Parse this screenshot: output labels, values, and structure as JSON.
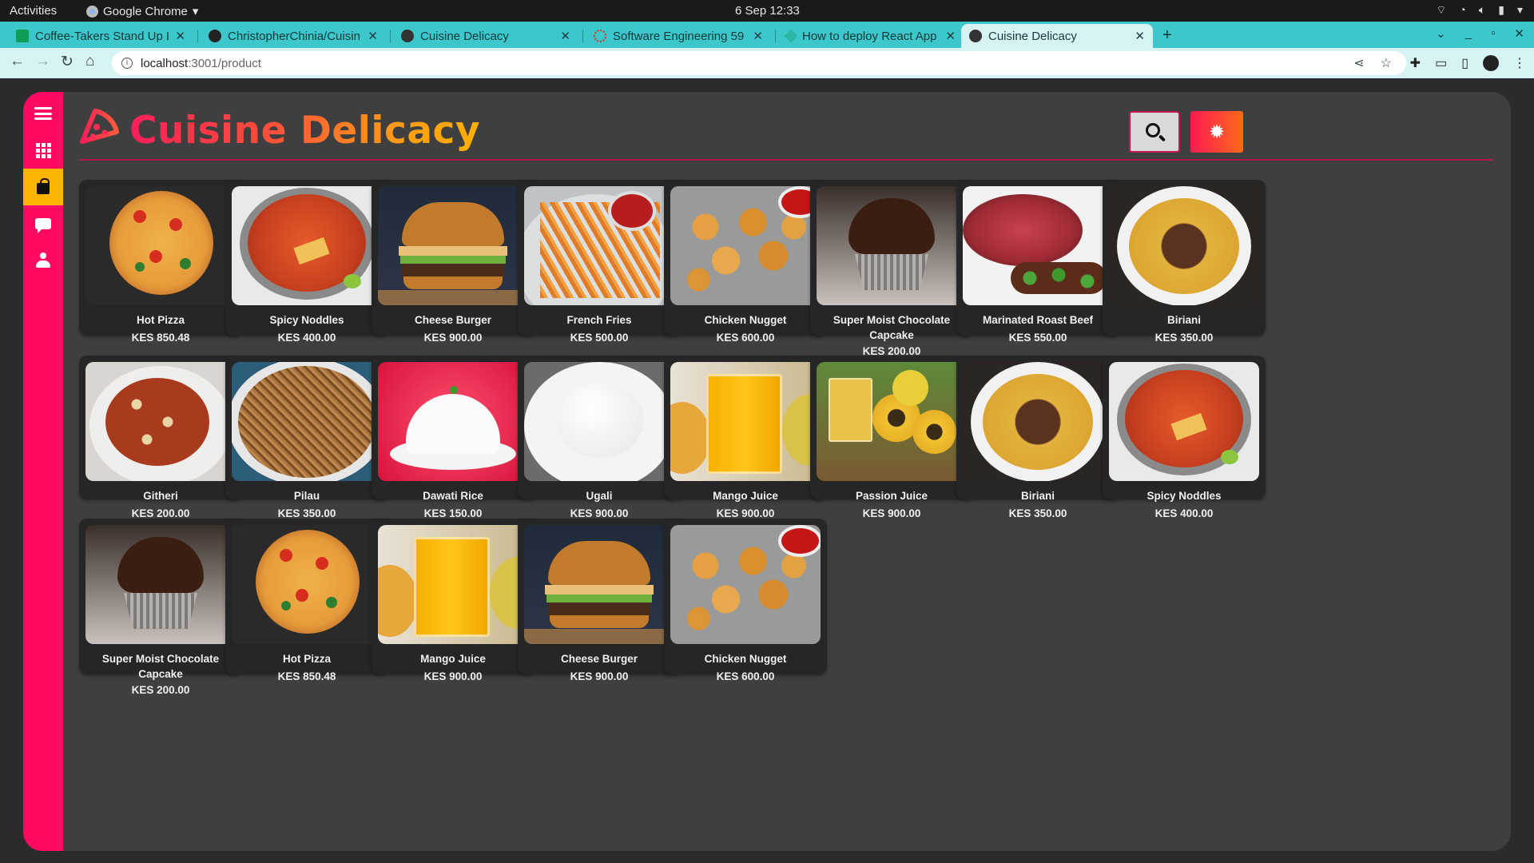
{
  "os": {
    "activities": "Activities",
    "app_name": "Google Chrome",
    "clock": "6 Sep  12:33"
  },
  "browser": {
    "tabs": [
      {
        "title": "Coffee-Takers Stand Up L",
        "favicon_color": "#0f9d58"
      },
      {
        "title": "ChristopherChinia/Cuisin",
        "favicon_color": "#222222"
      },
      {
        "title": "Cuisine Delicacy",
        "favicon_color": "#333333"
      },
      {
        "title": "Software Engineering 59",
        "favicon_color": "#d93025"
      },
      {
        "title": "How to deploy React App",
        "favicon_color": "#2bb6a3"
      },
      {
        "title": "Cuisine Delicacy",
        "favicon_color": "#333333"
      }
    ],
    "active_tab": 5,
    "url_host": "localhost",
    "url_path": ":3001/product"
  },
  "app": {
    "brand": "Cuisine Delicacy",
    "sidebar": [
      "menu-icon",
      "grid-icon",
      "shopping-bag-icon",
      "chat-icon",
      "user-icon"
    ],
    "colors": {
      "accent": "#ff0a63",
      "active": "#ffb400",
      "panel": "#3f3f3f",
      "card": "#262626"
    }
  },
  "products": [
    {
      "name": "Hot Pizza",
      "price": "KES 850.48",
      "kind": "pizza"
    },
    {
      "name": "Spicy Noddles",
      "price": "KES 400.00",
      "kind": "noodles"
    },
    {
      "name": "Cheese Burger",
      "price": "KES 900.00",
      "kind": "burger"
    },
    {
      "name": "French Fries",
      "price": "KES 500.00",
      "kind": "fries"
    },
    {
      "name": "Chicken Nugget",
      "price": "KES 600.00",
      "kind": "nuggets"
    },
    {
      "name": "Super Moist Chocolate Capcake",
      "price": "KES 200.00",
      "kind": "cupcake"
    },
    {
      "name": "Marinated Roast Beef",
      "price": "KES 550.00",
      "kind": "beef"
    },
    {
      "name": "Biriani",
      "price": "KES 350.00",
      "kind": "biriani"
    },
    {
      "name": "Githeri",
      "price": "KES 200.00",
      "kind": "githeri"
    },
    {
      "name": "Pilau",
      "price": "KES 350.00",
      "kind": "pilau"
    },
    {
      "name": "Dawati Rice",
      "price": "KES 150.00",
      "kind": "rice"
    },
    {
      "name": "Ugali",
      "price": "KES 900.00",
      "kind": "ugali"
    },
    {
      "name": "Mango Juice",
      "price": "KES 900.00",
      "kind": "juice"
    },
    {
      "name": "Passion Juice",
      "price": "KES 900.00",
      "kind": "passion"
    },
    {
      "name": "Biriani",
      "price": "KES 350.00",
      "kind": "biriani"
    },
    {
      "name": "Spicy Noddles",
      "price": "KES 400.00",
      "kind": "noodles"
    },
    {
      "name": "Super Moist Chocolate Capcake",
      "price": "KES 200.00",
      "kind": "cupcake"
    },
    {
      "name": "Hot Pizza",
      "price": "KES 850.48",
      "kind": "pizza"
    },
    {
      "name": "Mango Juice",
      "price": "KES 900.00",
      "kind": "juice"
    },
    {
      "name": "Cheese Burger",
      "price": "KES 900.00",
      "kind": "burger"
    },
    {
      "name": "Chicken Nugget",
      "price": "KES 600.00",
      "kind": "nuggets"
    }
  ]
}
